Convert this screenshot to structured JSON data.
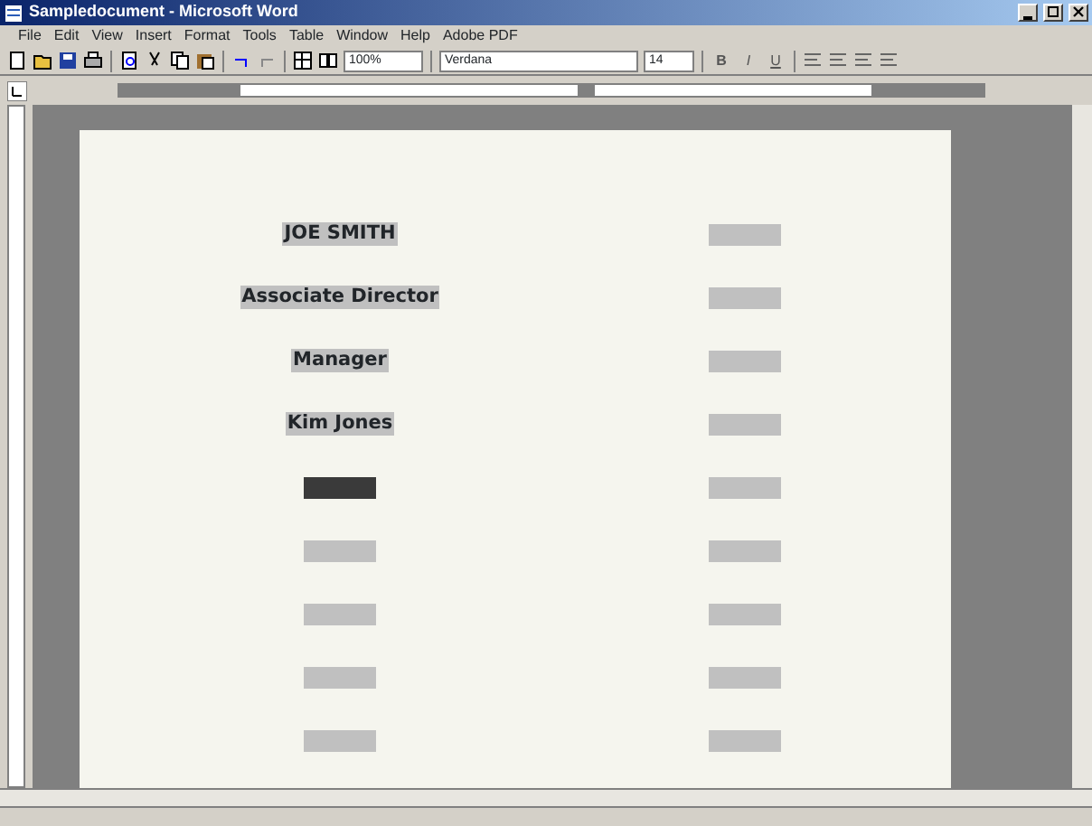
{
  "window": {
    "title": "Sampledocument - Microsoft Word"
  },
  "menu": [
    "File",
    "Edit",
    "View",
    "Insert",
    "Format",
    "Tools",
    "Table",
    "Window",
    "Help",
    "Adobe PDF"
  ],
  "toolbar": {
    "zoom": "100%",
    "font": "Verdana",
    "size": "14",
    "format_buttons": [
      "B",
      "I",
      "U"
    ]
  },
  "document": {
    "rows": [
      {
        "left": {
          "kind": "text",
          "text": "JOE SMITH"
        }
      },
      {
        "left": {
          "kind": "text",
          "text": "Associate Director"
        }
      },
      {
        "left": {
          "kind": "text",
          "text": "Manager"
        }
      },
      {
        "left": {
          "kind": "text",
          "text": "Kim Jones"
        }
      },
      {
        "left": {
          "kind": "blank",
          "selected": true
        }
      },
      {
        "left": {
          "kind": "blank",
          "selected": false
        }
      },
      {
        "left": {
          "kind": "blank",
          "selected": false
        }
      },
      {
        "left": {
          "kind": "blank",
          "selected": false
        }
      },
      {
        "left": {
          "kind": "blank",
          "selected": false
        }
      }
    ]
  }
}
